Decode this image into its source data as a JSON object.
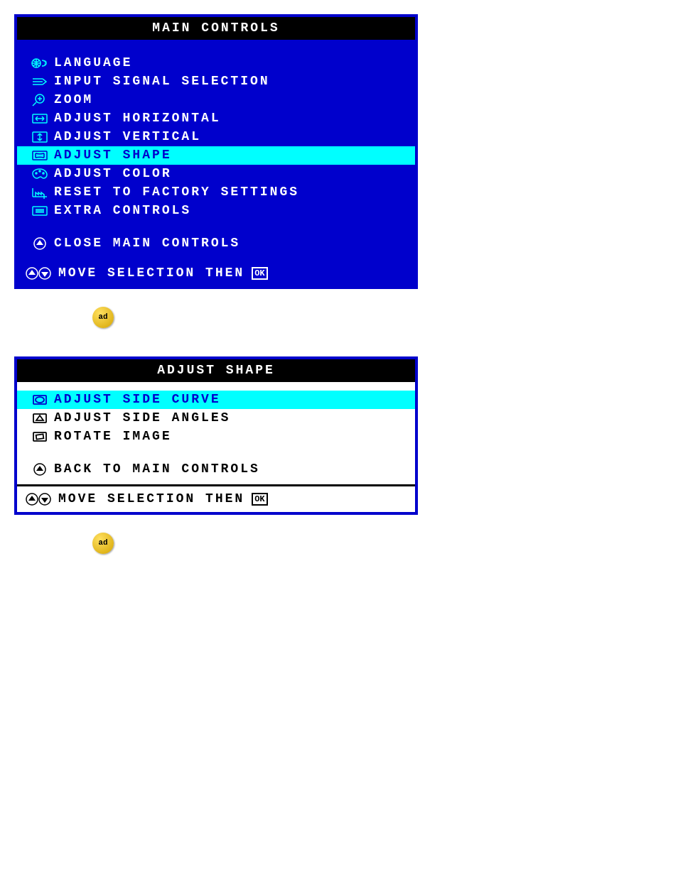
{
  "main_menu": {
    "title": "MAIN CONTROLS",
    "items": [
      {
        "label": "LANGUAGE"
      },
      {
        "label": "INPUT SIGNAL SELECTION"
      },
      {
        "label": "ZOOM"
      },
      {
        "label": "ADJUST HORIZONTAL"
      },
      {
        "label": "ADJUST VERTICAL"
      },
      {
        "label": "ADJUST SHAPE"
      },
      {
        "label": "ADJUST COLOR"
      },
      {
        "label": "RESET TO FACTORY SETTINGS"
      },
      {
        "label": "EXTRA CONTROLS"
      }
    ],
    "close": "CLOSE MAIN CONTROLS",
    "footer": "MOVE SELECTION THEN",
    "selected_index": 5
  },
  "shape_menu": {
    "title": "ADJUST SHAPE",
    "items": [
      {
        "label": "ADJUST SIDE CURVE"
      },
      {
        "label": "ADJUST SIDE ANGLES"
      },
      {
        "label": "ROTATE IMAGE"
      }
    ],
    "back": "BACK TO MAIN CONTROLS",
    "footer": "MOVE SELECTION THEN",
    "selected_index": 0
  },
  "ok_label": "ad"
}
